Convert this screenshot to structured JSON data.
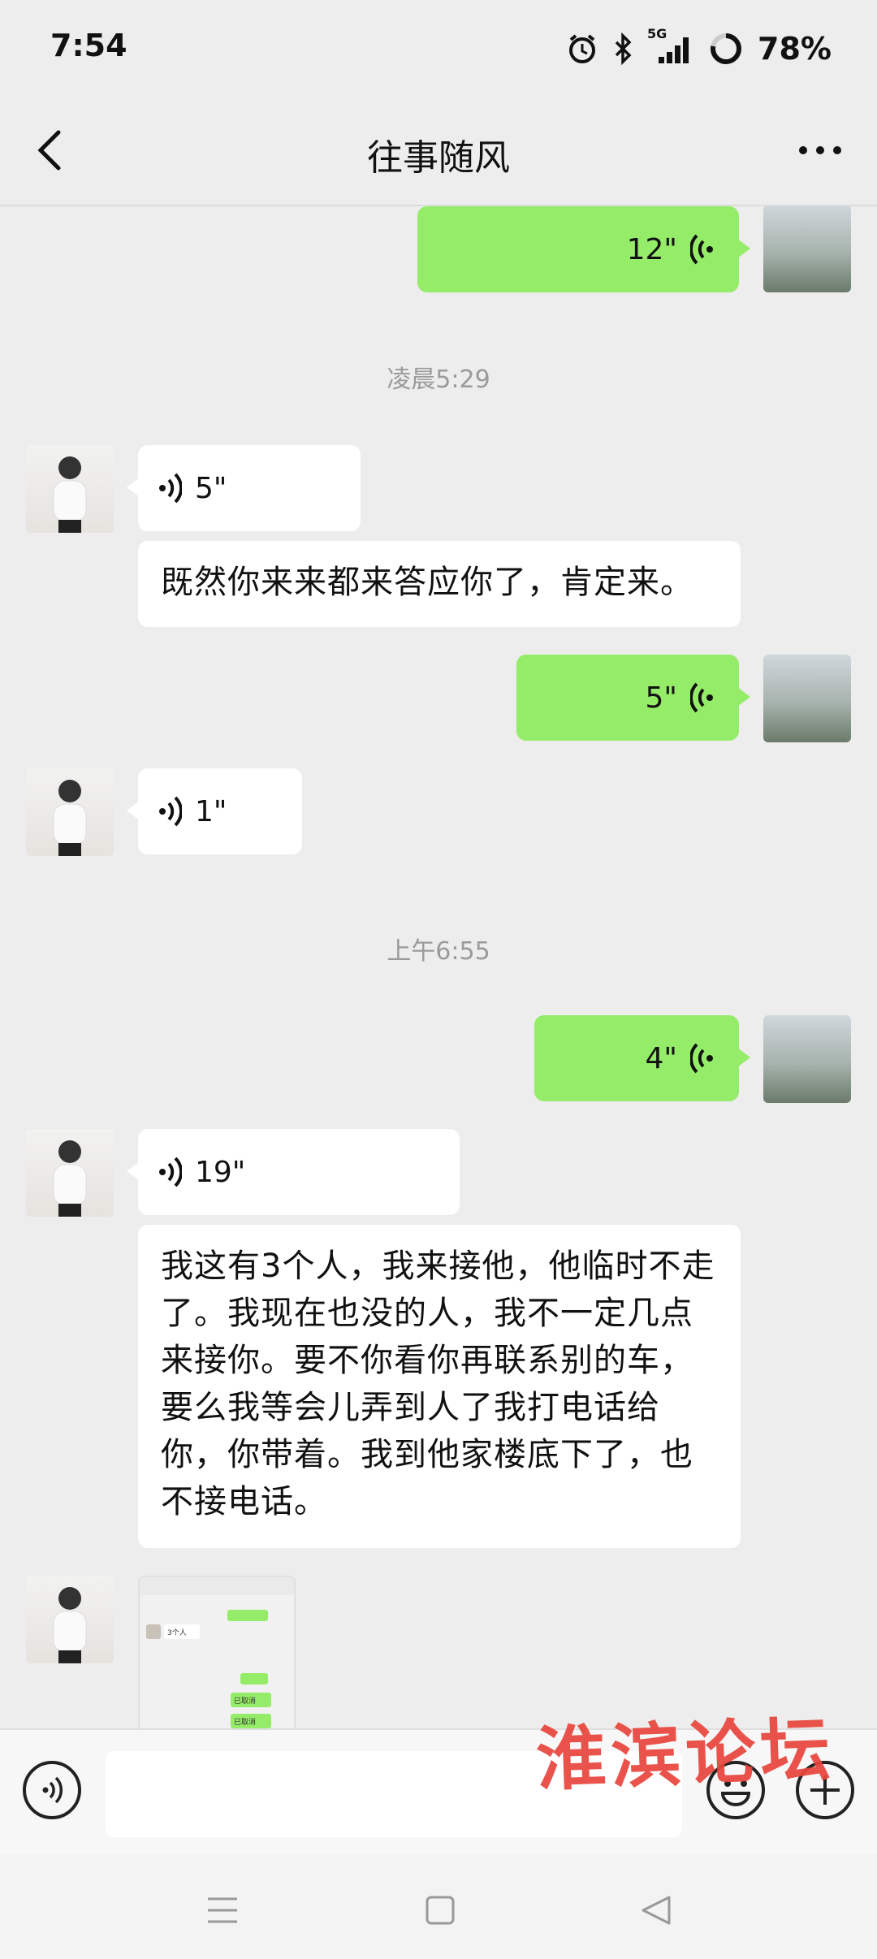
{
  "status_bar": {
    "time": "7:54",
    "network": "5G",
    "battery": "78%",
    "icons": [
      "alarm-icon",
      "bluetooth-icon",
      "signal-icon",
      "battery-ring-icon"
    ]
  },
  "header": {
    "title": "往事随风",
    "back_icon": "chevron-left-icon",
    "more_icon": "more-horizontal-icon"
  },
  "messages": [
    {
      "sender": "me",
      "type": "voice",
      "duration": "12\""
    },
    {
      "type": "timestamp",
      "text": "凌晨5:29"
    },
    {
      "sender": "other",
      "type": "voice",
      "duration": "5\""
    },
    {
      "sender": "other",
      "type": "text",
      "text": "既然你来来都来答应你了，肯定来。"
    },
    {
      "sender": "me",
      "type": "voice",
      "duration": "5\""
    },
    {
      "sender": "other",
      "type": "voice",
      "duration": "1\""
    },
    {
      "type": "timestamp",
      "text": "上午6:55"
    },
    {
      "sender": "me",
      "type": "voice",
      "duration": "4\""
    },
    {
      "sender": "other",
      "type": "voice",
      "duration": "19\""
    },
    {
      "sender": "other",
      "type": "text",
      "text": "我这有3个人，我来接他，他临时不走了。我现在也没的人，我不一定几点来接你。要不你看你再联系别的车，要么我等会儿弄到人了我打电话给你，你带着。我到他家楼底下了，也不接电话。"
    },
    {
      "sender": "other",
      "type": "image",
      "preview_texts": [
        "3个人",
        "已取消",
        "已取消"
      ]
    }
  ],
  "input_bar": {
    "placeholder": "",
    "voice_icon": "voice-toggle-icon",
    "emoji_icon": "emoji-icon",
    "plus_icon": "plus-icon"
  },
  "watermark": "淮滨论坛",
  "nav_bar": {
    "icons": [
      "menu-icon",
      "home-icon",
      "back-triangle-icon"
    ]
  },
  "colors": {
    "my_bubble": "#95ec69",
    "other_bubble": "#ffffff",
    "background": "#ededed",
    "watermark": "#e8453c"
  }
}
